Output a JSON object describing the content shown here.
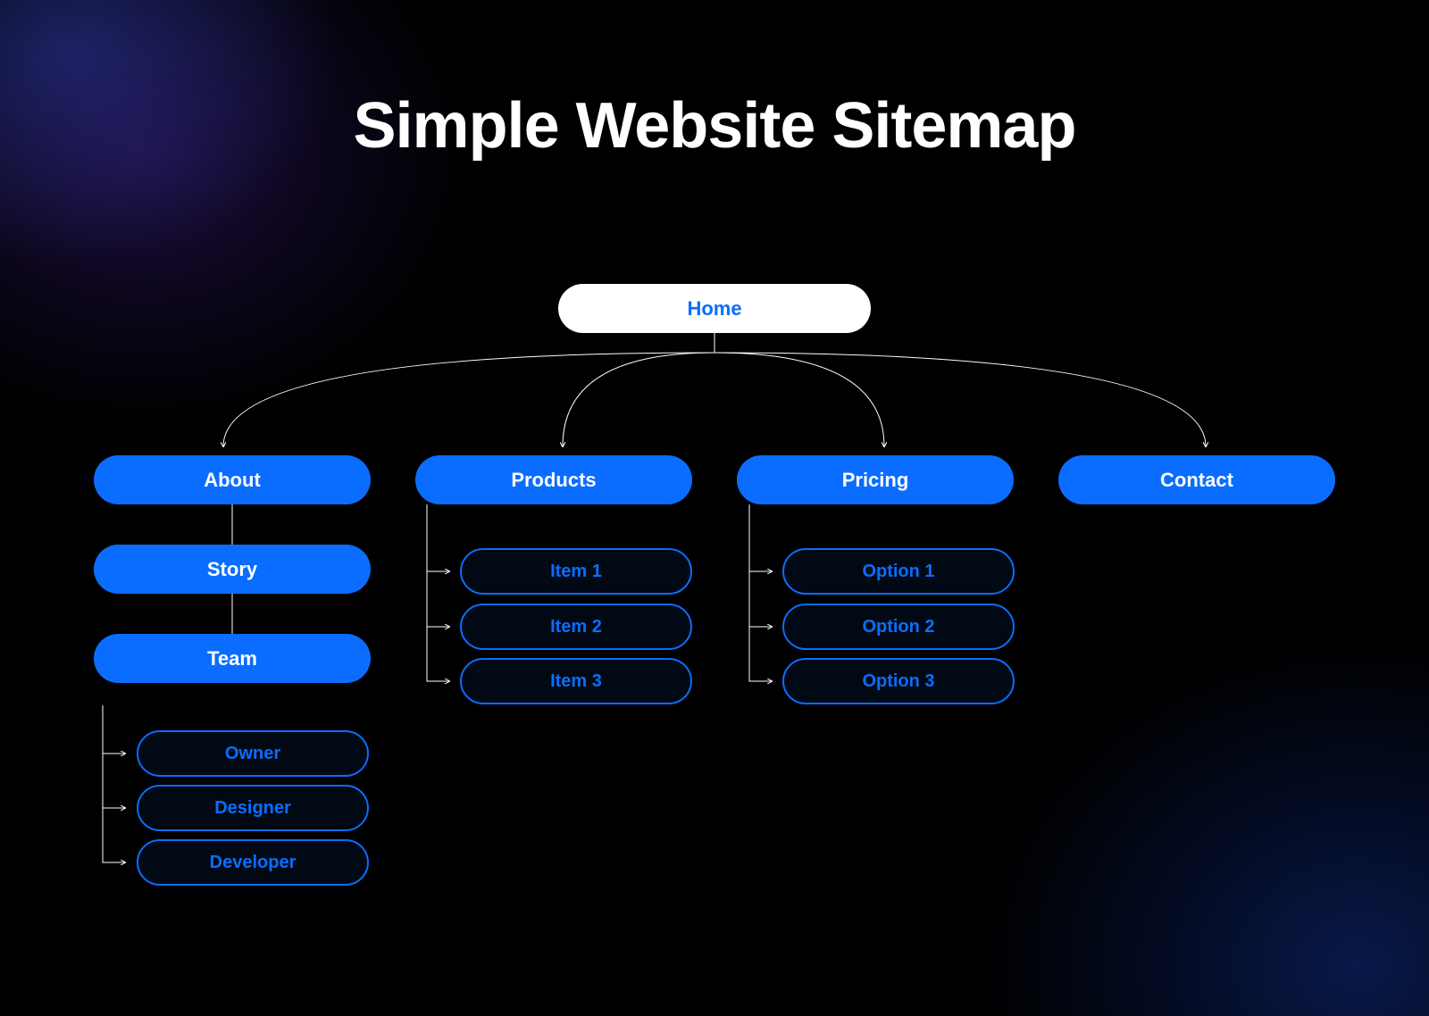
{
  "title": "Simple Website Sitemap",
  "nodes": {
    "home": "Home",
    "about": "About",
    "products": "Products",
    "pricing": "Pricing",
    "contact": "Contact",
    "story": "Story",
    "team": "Team",
    "team_owner": "Owner",
    "team_designer": "Designer",
    "team_developer": "Developer",
    "product_item1": "Item 1",
    "product_item2": "Item 2",
    "product_item3": "Item 3",
    "pricing_option1": "Option 1",
    "pricing_option2": "Option 2",
    "pricing_option3": "Option 3"
  },
  "colors": {
    "accent": "#0b6dff",
    "text_on_accent": "#ffffff",
    "bg": "#000000"
  }
}
